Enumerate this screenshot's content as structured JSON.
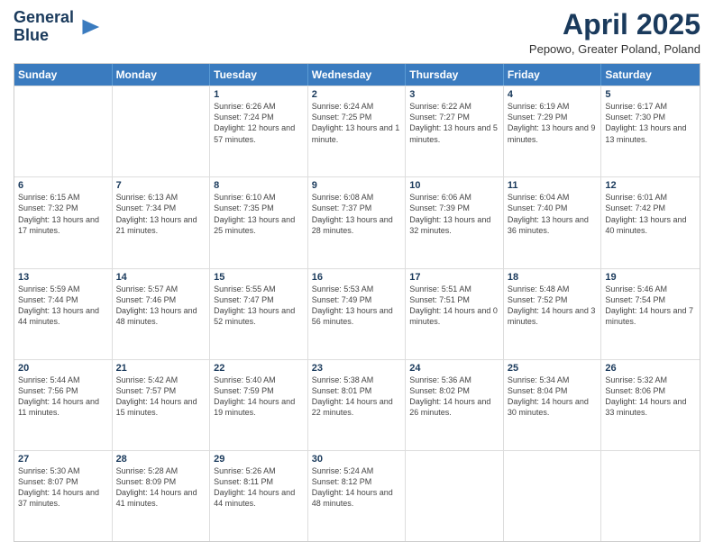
{
  "logo": {
    "line1": "General",
    "line2": "Blue"
  },
  "title": "April 2025",
  "location": "Pepowo, Greater Poland, Poland",
  "days": [
    "Sunday",
    "Monday",
    "Tuesday",
    "Wednesday",
    "Thursday",
    "Friday",
    "Saturday"
  ],
  "weeks": [
    [
      {
        "day": "",
        "info": ""
      },
      {
        "day": "",
        "info": ""
      },
      {
        "day": "1",
        "info": "Sunrise: 6:26 AM\nSunset: 7:24 PM\nDaylight: 12 hours and 57 minutes."
      },
      {
        "day": "2",
        "info": "Sunrise: 6:24 AM\nSunset: 7:25 PM\nDaylight: 13 hours and 1 minute."
      },
      {
        "day": "3",
        "info": "Sunrise: 6:22 AM\nSunset: 7:27 PM\nDaylight: 13 hours and 5 minutes."
      },
      {
        "day": "4",
        "info": "Sunrise: 6:19 AM\nSunset: 7:29 PM\nDaylight: 13 hours and 9 minutes."
      },
      {
        "day": "5",
        "info": "Sunrise: 6:17 AM\nSunset: 7:30 PM\nDaylight: 13 hours and 13 minutes."
      }
    ],
    [
      {
        "day": "6",
        "info": "Sunrise: 6:15 AM\nSunset: 7:32 PM\nDaylight: 13 hours and 17 minutes."
      },
      {
        "day": "7",
        "info": "Sunrise: 6:13 AM\nSunset: 7:34 PM\nDaylight: 13 hours and 21 minutes."
      },
      {
        "day": "8",
        "info": "Sunrise: 6:10 AM\nSunset: 7:35 PM\nDaylight: 13 hours and 25 minutes."
      },
      {
        "day": "9",
        "info": "Sunrise: 6:08 AM\nSunset: 7:37 PM\nDaylight: 13 hours and 28 minutes."
      },
      {
        "day": "10",
        "info": "Sunrise: 6:06 AM\nSunset: 7:39 PM\nDaylight: 13 hours and 32 minutes."
      },
      {
        "day": "11",
        "info": "Sunrise: 6:04 AM\nSunset: 7:40 PM\nDaylight: 13 hours and 36 minutes."
      },
      {
        "day": "12",
        "info": "Sunrise: 6:01 AM\nSunset: 7:42 PM\nDaylight: 13 hours and 40 minutes."
      }
    ],
    [
      {
        "day": "13",
        "info": "Sunrise: 5:59 AM\nSunset: 7:44 PM\nDaylight: 13 hours and 44 minutes."
      },
      {
        "day": "14",
        "info": "Sunrise: 5:57 AM\nSunset: 7:46 PM\nDaylight: 13 hours and 48 minutes."
      },
      {
        "day": "15",
        "info": "Sunrise: 5:55 AM\nSunset: 7:47 PM\nDaylight: 13 hours and 52 minutes."
      },
      {
        "day": "16",
        "info": "Sunrise: 5:53 AM\nSunset: 7:49 PM\nDaylight: 13 hours and 56 minutes."
      },
      {
        "day": "17",
        "info": "Sunrise: 5:51 AM\nSunset: 7:51 PM\nDaylight: 14 hours and 0 minutes."
      },
      {
        "day": "18",
        "info": "Sunrise: 5:48 AM\nSunset: 7:52 PM\nDaylight: 14 hours and 3 minutes."
      },
      {
        "day": "19",
        "info": "Sunrise: 5:46 AM\nSunset: 7:54 PM\nDaylight: 14 hours and 7 minutes."
      }
    ],
    [
      {
        "day": "20",
        "info": "Sunrise: 5:44 AM\nSunset: 7:56 PM\nDaylight: 14 hours and 11 minutes."
      },
      {
        "day": "21",
        "info": "Sunrise: 5:42 AM\nSunset: 7:57 PM\nDaylight: 14 hours and 15 minutes."
      },
      {
        "day": "22",
        "info": "Sunrise: 5:40 AM\nSunset: 7:59 PM\nDaylight: 14 hours and 19 minutes."
      },
      {
        "day": "23",
        "info": "Sunrise: 5:38 AM\nSunset: 8:01 PM\nDaylight: 14 hours and 22 minutes."
      },
      {
        "day": "24",
        "info": "Sunrise: 5:36 AM\nSunset: 8:02 PM\nDaylight: 14 hours and 26 minutes."
      },
      {
        "day": "25",
        "info": "Sunrise: 5:34 AM\nSunset: 8:04 PM\nDaylight: 14 hours and 30 minutes."
      },
      {
        "day": "26",
        "info": "Sunrise: 5:32 AM\nSunset: 8:06 PM\nDaylight: 14 hours and 33 minutes."
      }
    ],
    [
      {
        "day": "27",
        "info": "Sunrise: 5:30 AM\nSunset: 8:07 PM\nDaylight: 14 hours and 37 minutes."
      },
      {
        "day": "28",
        "info": "Sunrise: 5:28 AM\nSunset: 8:09 PM\nDaylight: 14 hours and 41 minutes."
      },
      {
        "day": "29",
        "info": "Sunrise: 5:26 AM\nSunset: 8:11 PM\nDaylight: 14 hours and 44 minutes."
      },
      {
        "day": "30",
        "info": "Sunrise: 5:24 AM\nSunset: 8:12 PM\nDaylight: 14 hours and 48 minutes."
      },
      {
        "day": "",
        "info": ""
      },
      {
        "day": "",
        "info": ""
      },
      {
        "day": "",
        "info": ""
      }
    ]
  ]
}
